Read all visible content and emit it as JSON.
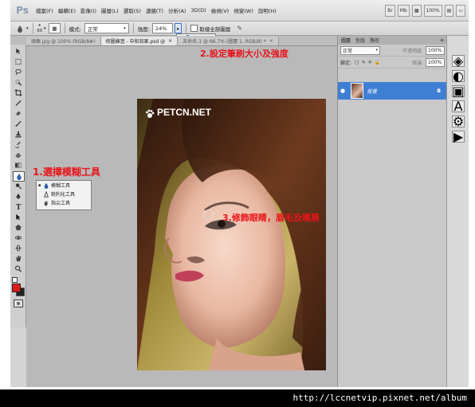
{
  "menubar": {
    "logo": "Ps",
    "items": [
      "檔案(F)",
      "編輯(E)",
      "影像(I)",
      "圖層(L)",
      "選取(S)",
      "濾鏡(T)",
      "分析(A)",
      "3D(D)",
      "檢視(V)",
      "視窗(W)",
      "說明(H)"
    ],
    "zoom": "100%"
  },
  "options": {
    "brush_size": "60",
    "mode_label": "模式:",
    "mode_value": "正常",
    "strength_label": "強度:",
    "strength_value": "24%",
    "sample_all_label": "取樣全部圖層"
  },
  "tabs": [
    "頭像.jpg @ 100% (RGB/8#)",
    "修圖練習 - 中和效果.psd @",
    "未命名-1 @ 66.7% (圖層 1, RGB/8) *"
  ],
  "flyout": {
    "items": [
      "模糊工具",
      "銳利化工具",
      "指尖工具"
    ]
  },
  "annotations": {
    "step1": "1.選擇模糊工具",
    "step2": "2.設定筆刷大小及強度",
    "step3": "3.修飾眼睛，眉毛及嘴唇"
  },
  "watermark": "PETCN.NET",
  "layers": {
    "tabs": [
      "圖層",
      "色版",
      "路徑"
    ],
    "blend_mode": "正常",
    "opacity_label": "不透明度:",
    "opacity_value": "100%",
    "lock_label": "鎖定:",
    "fill_label": "填滿:",
    "fill_value": "100%",
    "layer_name": "背景"
  },
  "footer": {
    "url": "http://lccnetvip.pixnet.net/album"
  }
}
